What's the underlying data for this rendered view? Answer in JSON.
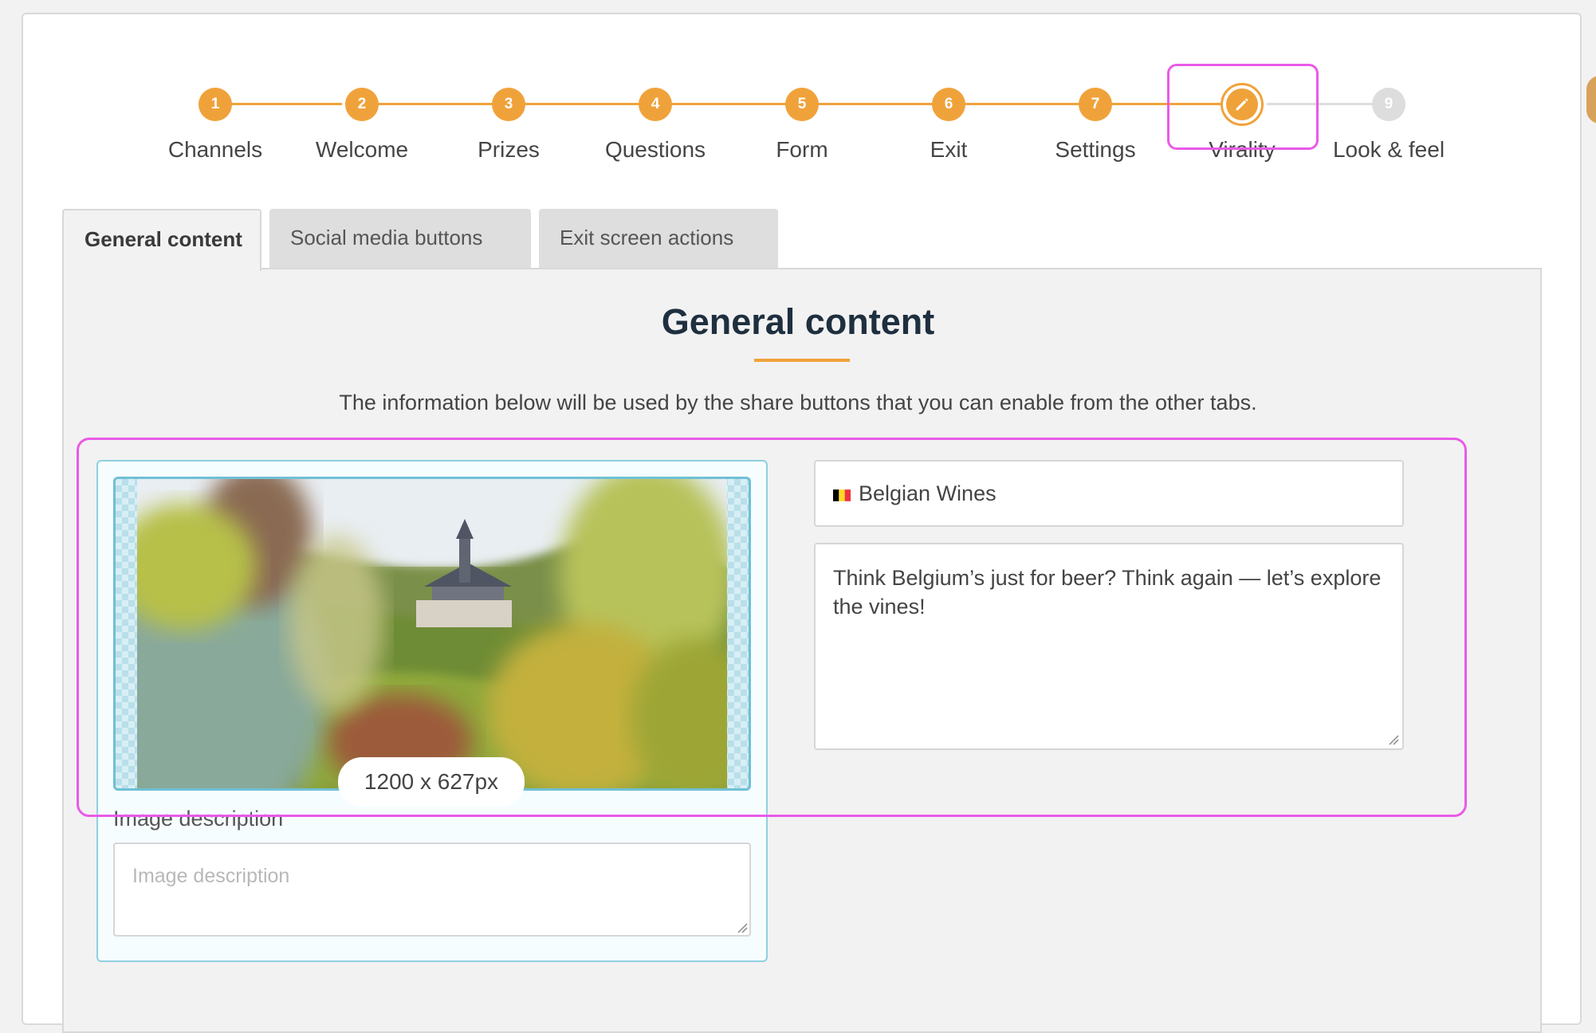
{
  "colors": {
    "accent": "#f0a23a",
    "inactive_step": "#dddddd",
    "highlight": "#e95ae8",
    "title": "#1e2f3f"
  },
  "stepper": {
    "steps": [
      {
        "number": "1",
        "label": "Channels",
        "state": "done"
      },
      {
        "number": "2",
        "label": "Welcome",
        "state": "done"
      },
      {
        "number": "3",
        "label": "Prizes",
        "state": "done"
      },
      {
        "number": "4",
        "label": "Questions",
        "state": "done"
      },
      {
        "number": "5",
        "label": "Form",
        "state": "done"
      },
      {
        "number": "6",
        "label": "Exit",
        "state": "done"
      },
      {
        "number": "7",
        "label": "Settings",
        "state": "done"
      },
      {
        "number": "",
        "label": "Virality",
        "state": "current",
        "icon": "pencil-icon"
      },
      {
        "number": "9",
        "label": "Look & feel",
        "state": "todo"
      }
    ]
  },
  "tabs": [
    {
      "label": "General content",
      "active": true
    },
    {
      "label": "Social media buttons",
      "active": false
    },
    {
      "label": "Exit screen actions",
      "active": false
    }
  ],
  "section": {
    "title": "General content",
    "intro": "The information below will be used by the share buttons that you can enable from the other tabs."
  },
  "image": {
    "size_label": "1200 x 627px",
    "description_label": "Image description",
    "description_placeholder": "Image description",
    "description_value": ""
  },
  "share": {
    "title_flag": "belgium-flag-icon",
    "title_value": "Belgian Wines",
    "description_value": "Think Belgium’s just for beer? Think again — let’s explore the vines!"
  }
}
